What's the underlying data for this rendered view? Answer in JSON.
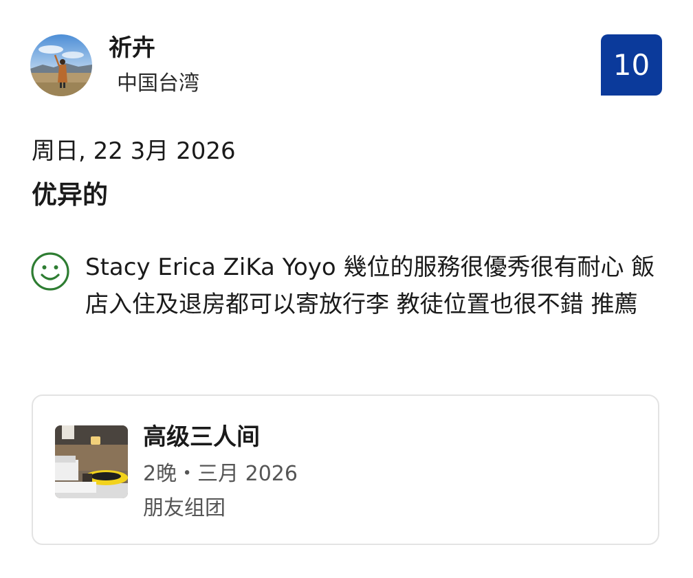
{
  "reviewer": {
    "name": "祈卉",
    "country": "中国台湾",
    "avatar_icon": "user-photo-avatar"
  },
  "score": {
    "value": "10",
    "color": "#0b3a9b"
  },
  "review": {
    "date": "周日, 22 3月 2026",
    "headline": "优异的",
    "positive_icon": "smiley-face-icon",
    "positive_color": "#2e7d32",
    "text": "Stacy Erica ZiKa Yoyo 幾位的服務很優秀很有耐心 飯店入住及退房都可以寄放行李 教徒位置也很不錯 推薦"
  },
  "stay": {
    "room_name": "高级三人间",
    "nights_and_month": "2晚・三月 2026",
    "traveler_type": "朋友组团",
    "thumbnail_icon": "hotel-room-photo"
  }
}
